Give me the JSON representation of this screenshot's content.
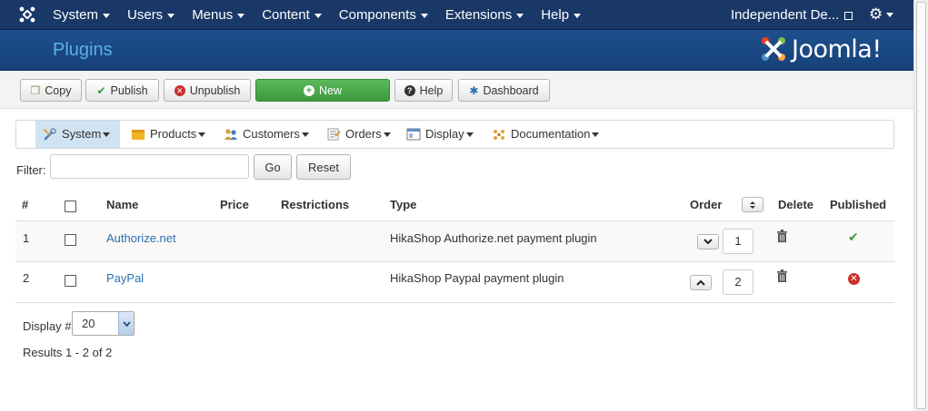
{
  "navbar": {
    "menu": [
      {
        "label": "System"
      },
      {
        "label": "Users"
      },
      {
        "label": "Menus"
      },
      {
        "label": "Content"
      },
      {
        "label": "Components"
      },
      {
        "label": "Extensions"
      },
      {
        "label": "Help"
      }
    ],
    "site_name": "Independent De...",
    "gear_icon": "gear-icon"
  },
  "header": {
    "title": "Plugins",
    "brand": "Joomla!"
  },
  "toolbar": {
    "copy": "Copy",
    "publish": "Publish",
    "unpublish": "Unpublish",
    "new": "New",
    "help": "Help",
    "dashboard": "Dashboard"
  },
  "submenu": [
    {
      "label": "System",
      "icon": "wrench-icon"
    },
    {
      "label": "Products",
      "icon": "box-icon"
    },
    {
      "label": "Customers",
      "icon": "users-icon"
    },
    {
      "label": "Orders",
      "icon": "orders-icon"
    },
    {
      "label": "Display",
      "icon": "display-icon"
    },
    {
      "label": "Documentation",
      "icon": "documentation-icon"
    }
  ],
  "filter": {
    "label": "Filter:",
    "value": "",
    "go": "Go",
    "reset": "Reset"
  },
  "table": {
    "headers": {
      "num": "#",
      "name": "Name",
      "price": "Price",
      "restrictions": "Restrictions",
      "type": "Type",
      "order": "Order",
      "delete": "Delete",
      "published": "Published"
    },
    "rows": [
      {
        "num": "1",
        "name": "Authorize.net",
        "type": "HikaShop Authorize.net payment plugin",
        "order": "1",
        "published": true
      },
      {
        "num": "2",
        "name": "PayPal",
        "type": "HikaShop Paypal payment plugin",
        "order": "2",
        "published": false
      }
    ]
  },
  "footer": {
    "display_label": "Display #",
    "display_value": "20",
    "results": "Results 1 - 2 of 2"
  },
  "colors": {
    "navbar": "#1a3867",
    "header": "#1c4a85",
    "new_button": "#4aa84a",
    "link": "#2a6fb0",
    "published": "#3c9a3c",
    "unpublished": "#c9302c"
  }
}
